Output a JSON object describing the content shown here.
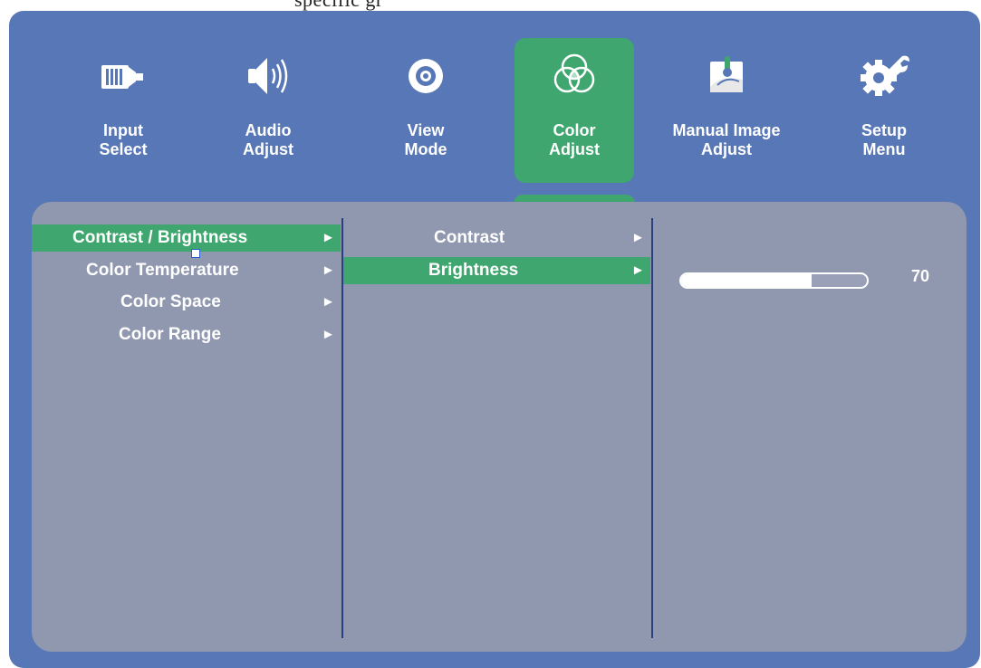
{
  "header": {
    "partial_text": "specific gr"
  },
  "tabs": [
    {
      "id": "input",
      "label": "Input\nSelect",
      "icon": "input-select-icon"
    },
    {
      "id": "audio",
      "label": "Audio\nAdjust",
      "icon": "speaker-icon"
    },
    {
      "id": "view",
      "label": "View\nMode",
      "icon": "eye-icon"
    },
    {
      "id": "color",
      "label": "Color\nAdjust",
      "icon": "color-circles-icon",
      "active": true
    },
    {
      "id": "manual",
      "label": "Manual Image\nAdjust",
      "icon": "image-adjust-icon"
    },
    {
      "id": "setup",
      "label": "Setup\nMenu",
      "icon": "wrench-gear-icon"
    }
  ],
  "menu": {
    "level1": [
      {
        "label": "Contrast / Brightness",
        "selected": true
      },
      {
        "label": "Color Temperature"
      },
      {
        "label": "Color Space"
      },
      {
        "label": "Color Range"
      }
    ],
    "level2": [
      {
        "label": "Contrast"
      },
      {
        "label": "Brightness",
        "selected": true
      }
    ],
    "arrow": "►"
  },
  "slider": {
    "value": 70,
    "display": "70",
    "max": 100
  },
  "colors": {
    "osd_bg": "#5877b6",
    "panel_bg": "#9098b0",
    "highlight": "#3ea66e",
    "divider": "#2a3f82",
    "text": "#ffffff"
  }
}
